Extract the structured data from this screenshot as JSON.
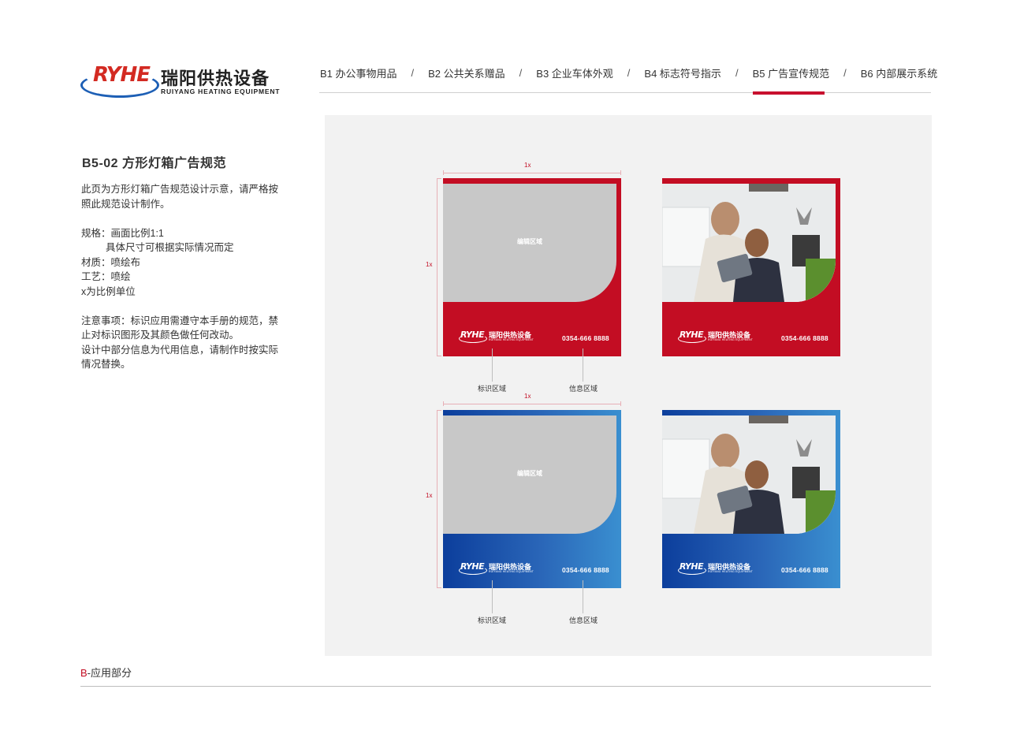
{
  "header": {
    "logo": {
      "mark": "RYHE",
      "cn": "瑞阳供热设备",
      "en": "RUIYANG HEATING EQUIPMENT"
    },
    "nav": [
      {
        "label": "B1 办公事物用品"
      },
      {
        "label": "B2 公共关系赠品"
      },
      {
        "label": "B3 企业车体外观"
      },
      {
        "label": "B4 标志符号指示"
      },
      {
        "label": "B5 广告宣传规范",
        "active": true
      },
      {
        "label": "B6 内部展示系统"
      }
    ],
    "separator": "/",
    "accent_color": "#c8102e"
  },
  "left": {
    "title": "B5-02  方形灯箱广告规范",
    "intro": "此页为方形灯箱广告规范设计示意，请严格按照此规范设计制作。",
    "spec_line1": "规格：画面比例1:1",
    "spec_line2": "具体尺寸可根据实际情况而定",
    "material": "材质：喷绘布",
    "craft": "工艺：喷绘",
    "unit": "x为比例单位",
    "note1": "注意事项：标识应用需遵守本手册的规范，禁止对标识图形及其颜色做任何改动。",
    "note2": "设计中部分信息为代用信息，请制作时按实际情况替换。"
  },
  "panels": {
    "edit_label": "编辑区域",
    "phone": "0354-666 8888",
    "logo_mark": "RYHE",
    "logo_cn": "瑞阳供热设备",
    "logo_en": "RUIYANG HEATING EQUIPMENT",
    "dim_label": "1x",
    "logo_area_label": "标识区域",
    "info_area_label": "信息区域",
    "colors": {
      "red": "#c30d23",
      "blue_start": "#0c3e9c",
      "blue_end": "#3a8fd0",
      "edit_gray": "#c8c8c8"
    }
  },
  "footer": {
    "prefix": "B",
    "text": "-应用部分"
  }
}
